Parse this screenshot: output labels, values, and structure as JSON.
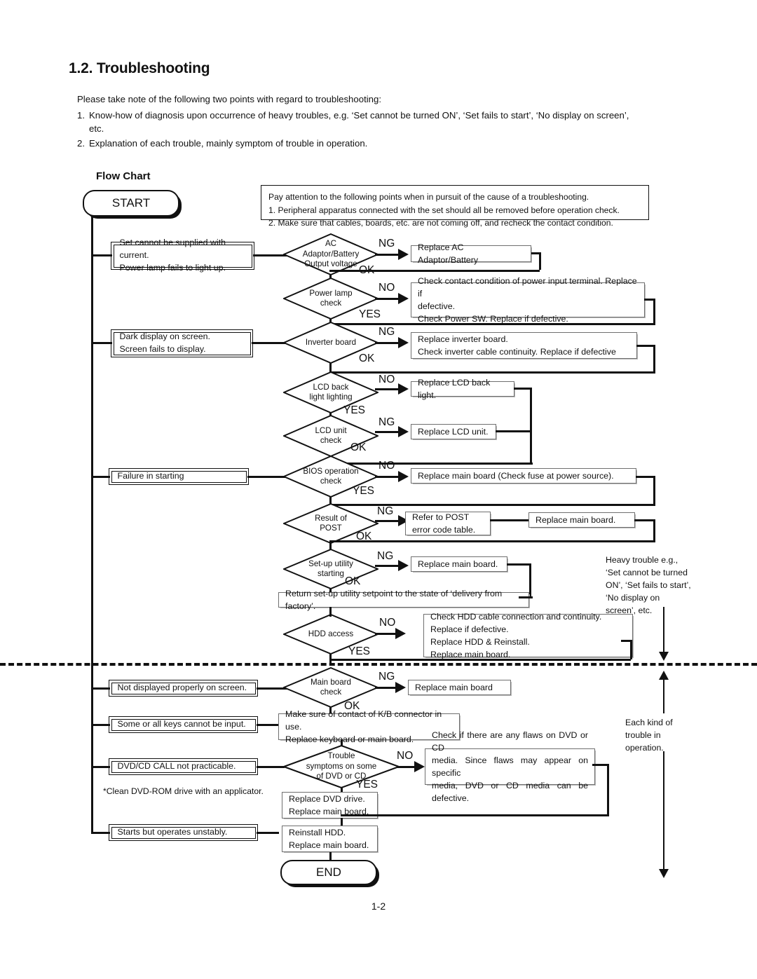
{
  "document": {
    "title": "1.2. Troubleshooting",
    "page_number": "1-2",
    "intro_lead": "Please take note of the following two points with regard to troubleshooting:",
    "intro_items": [
      {
        "num": "1.",
        "text": "Know-how of diagnosis upon occurrence of heavy troubles, e.g. ‘Set cannot be turned ON’, ‘Set fails to start’, ‘No display on screen’, etc."
      },
      {
        "num": "2.",
        "text": "Explanation of each trouble, mainly symptom of trouble in operation."
      }
    ]
  },
  "flow": {
    "section_label": "Flow Chart",
    "start_label": "START",
    "end_label": "END",
    "note": {
      "lead": "Pay attention to the following points when in pursuit of the cause of a troubleshooting.",
      "items": [
        "1. Peripheral apparatus connected with the set should all be removed before operation check.",
        "2. Make sure that cables, boards, etc. are not coming off, and recheck the contact condition."
      ]
    },
    "symptoms": [
      {
        "line1": "Set cannot be supplied with current.",
        "line2": "Power lamp fails to light up."
      },
      {
        "line1": "Dark display on screen.",
        "line2": "Screen fails to display."
      },
      {
        "line1": "Failure in starting",
        "line2": ""
      },
      {
        "line1": "Not displayed properly on screen.",
        "line2": ""
      },
      {
        "line1": "Some or all keys cannot be input.",
        "line2": ""
      },
      {
        "line1": "DVD/CD CALL not practicable.",
        "line2": ""
      },
      {
        "line1": "Starts but operates unstably.",
        "line2": ""
      }
    ],
    "decisions": [
      {
        "label_l1": "AC",
        "label_l2": "Adaptor/Battery",
        "label_l3": "Output voltage",
        "branch_fail": "NG",
        "branch_pass": "OK"
      },
      {
        "label_l1": "Power lamp",
        "label_l2": "check",
        "label_l3": "",
        "branch_fail": "NO",
        "branch_pass": "YES"
      },
      {
        "label_l1": "Inverter board",
        "label_l2": "",
        "label_l3": "",
        "branch_fail": "NG",
        "branch_pass": "OK"
      },
      {
        "label_l1": "LCD back",
        "label_l2": "light lighting",
        "label_l3": "",
        "branch_fail": "NO",
        "branch_pass": "YES"
      },
      {
        "label_l1": "LCD unit",
        "label_l2": "check",
        "label_l3": "",
        "branch_fail": "NG",
        "branch_pass": "OK"
      },
      {
        "label_l1": "BIOS operation",
        "label_l2": "check",
        "label_l3": "",
        "branch_fail": "NO",
        "branch_pass": "YES"
      },
      {
        "label_l1": "Result of",
        "label_l2": "POST",
        "label_l3": "",
        "branch_fail": "NG",
        "branch_pass": "OK"
      },
      {
        "label_l1": "Set-up utility",
        "label_l2": "starting",
        "label_l3": "",
        "branch_fail": "NG",
        "branch_pass": "OK"
      },
      {
        "label_l1": "HDD access",
        "label_l2": "",
        "label_l3": "",
        "branch_fail": "NO",
        "branch_pass": "YES"
      },
      {
        "label_l1": "Main board",
        "label_l2": "check",
        "label_l3": "",
        "branch_fail": "NG",
        "branch_pass": "OK"
      },
      {
        "label_l1": "Trouble",
        "label_l2": "symptoms on some",
        "label_l3": "of DVD or CD",
        "branch_fail": "NO",
        "branch_pass": "YES"
      }
    ],
    "actions": {
      "replace_ac": "Replace AC Adaptor/Battery",
      "power_terminal_l1": "Check contact condition of power input terminal. Replace if",
      "power_terminal_l2": "defective.",
      "power_terminal_l3": "Check Power SW. Replace if defective.",
      "inverter_l1": "Replace inverter board.",
      "inverter_l2": "Check inverter cable continuity. Replace if defective",
      "lcd_backlight": "Replace LCD back light.",
      "lcd_unit": "Replace LCD unit.",
      "bios_main_board": "Replace main board (Check fuse at power source).",
      "post_l1": "Refer to POST",
      "post_l2": "error code table.",
      "post_main_board": "Replace main board.",
      "setup_main_board": "Replace main board.",
      "setup_return": "Return set-up utility setpoint to the state of ‘delivery from factory’.",
      "hdd_l1": "Check HDD cable connection and continuity.",
      "hdd_l2": "Replace if defective.",
      "hdd_l3": "Replace HDD & Reinstall.",
      "hdd_l4": "Replace main board.",
      "mainboard_replace": "Replace main board",
      "keyboard_l1": "Make sure of contact of K/B connector in use.",
      "keyboard_l2": "Replace keyboard or main board.",
      "dvd_media_l1": "Check if there are any flaws on DVD or CD",
      "dvd_media_l2": "media. Since flaws may appear on specific",
      "dvd_media_l3": "media, DVD or CD media can be defective.",
      "dvd_replace_l1": "Replace DVD drive.",
      "dvd_replace_l2": "Replace main board.",
      "hdd_reinstall_l1": "Reinstall HDD.",
      "hdd_reinstall_l2": "Replace main board."
    },
    "footnote": "*Clean DVD-ROM drive with an applicator.",
    "annotations": {
      "heavy_trouble_l1": "Heavy trouble e.g.,",
      "heavy_trouble_l2": "‘Set cannot be turned",
      "heavy_trouble_l3": "ON’, ‘Set fails to start’,",
      "heavy_trouble_l4": "‘No display on",
      "heavy_trouble_l5": "screen’, etc.",
      "each_kind_l1": "Each kind of",
      "each_kind_l2": "trouble in",
      "each_kind_l3": "operation."
    }
  }
}
